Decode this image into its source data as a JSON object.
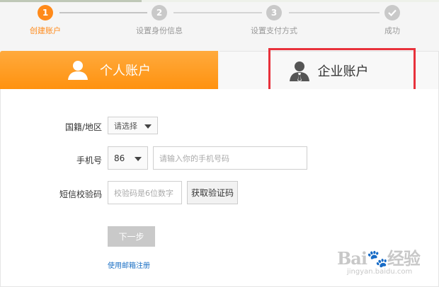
{
  "steps": [
    {
      "number": "1",
      "label": "创建账户",
      "state": "active"
    },
    {
      "number": "2",
      "label": "设置身份信息",
      "state": "pending"
    },
    {
      "number": "3",
      "label": "设置支付方式",
      "state": "pending"
    },
    {
      "number": "",
      "label": "成功",
      "state": "pending",
      "icon": "check-icon"
    }
  ],
  "tabs": {
    "personal": {
      "label": "个人账户",
      "icon": "person-icon"
    },
    "enterprise": {
      "label": "企业账户",
      "icon": "business-person-icon"
    }
  },
  "form": {
    "country": {
      "label": "国籍/地区",
      "value": "请选择"
    },
    "phone": {
      "label": "手机号",
      "code": "86",
      "placeholder": "请输入你的手机号码"
    },
    "sms": {
      "label": "短信校验码",
      "placeholder": "校验码是6位数字",
      "button": "获取验证码"
    },
    "next_button": "下一步",
    "email_link": "使用邮箱注册"
  },
  "watermark": {
    "logo": "Bai🐾经验",
    "url": "jingyan.baidu.com"
  },
  "colors": {
    "accent": "#ff8a1a",
    "highlight": "#e8313b",
    "link": "#1a6fc4"
  }
}
